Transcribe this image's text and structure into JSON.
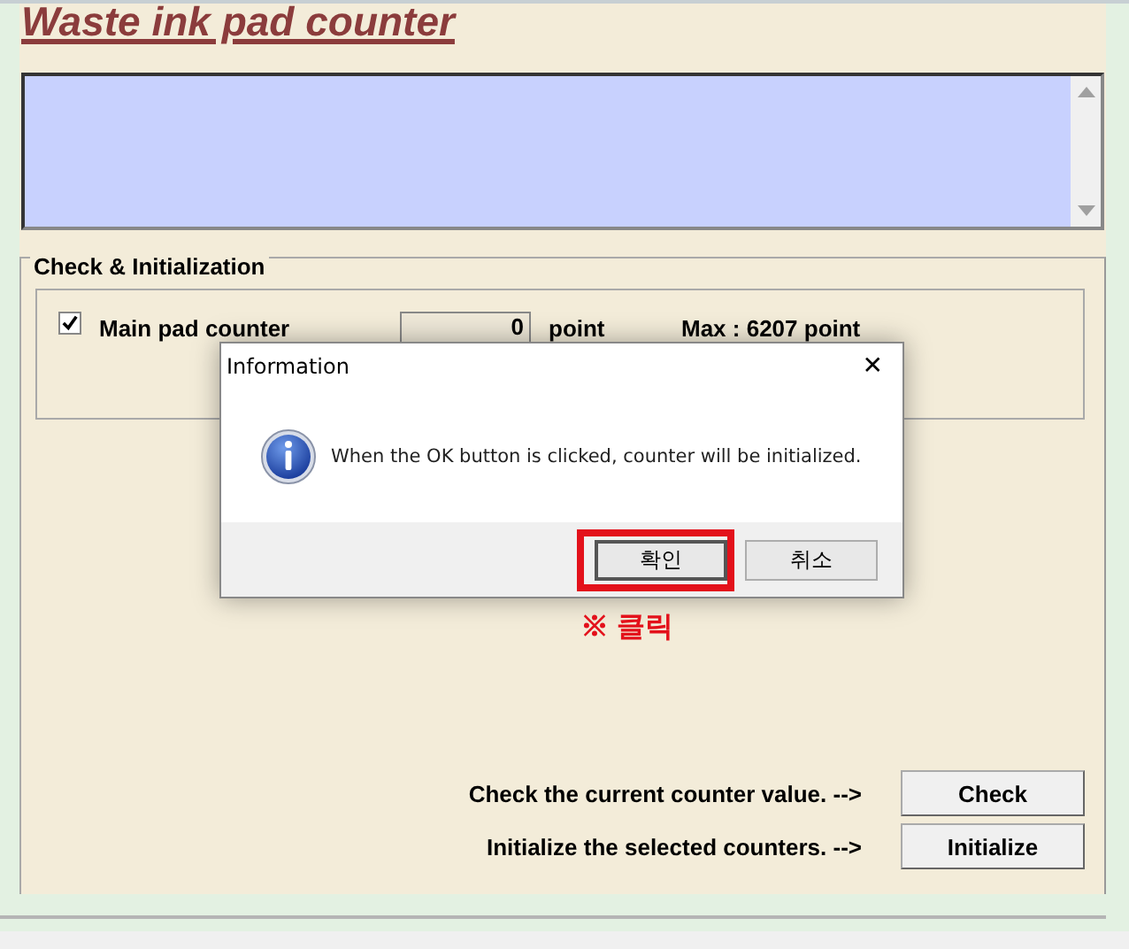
{
  "title": "Waste ink pad counter",
  "section": {
    "legend": "Check & Initialization",
    "counters": [
      {
        "label": "Main pad counter",
        "checked": true,
        "value": "0",
        "unit": "point",
        "max": "Max : 6207 point"
      }
    ]
  },
  "actions": [
    {
      "text": "Check the current counter value. -->",
      "button": "Check"
    },
    {
      "text": "Initialize the selected counters. -->",
      "button": "Initialize"
    }
  ],
  "dialog": {
    "title": "Information",
    "close": "✕",
    "message": "When the OK button is clicked, counter will be initialized.",
    "buttons": [
      {
        "label": "확인",
        "selected": true
      },
      {
        "label": "취소",
        "selected": false
      }
    ]
  },
  "annotation": "※ 클릭"
}
